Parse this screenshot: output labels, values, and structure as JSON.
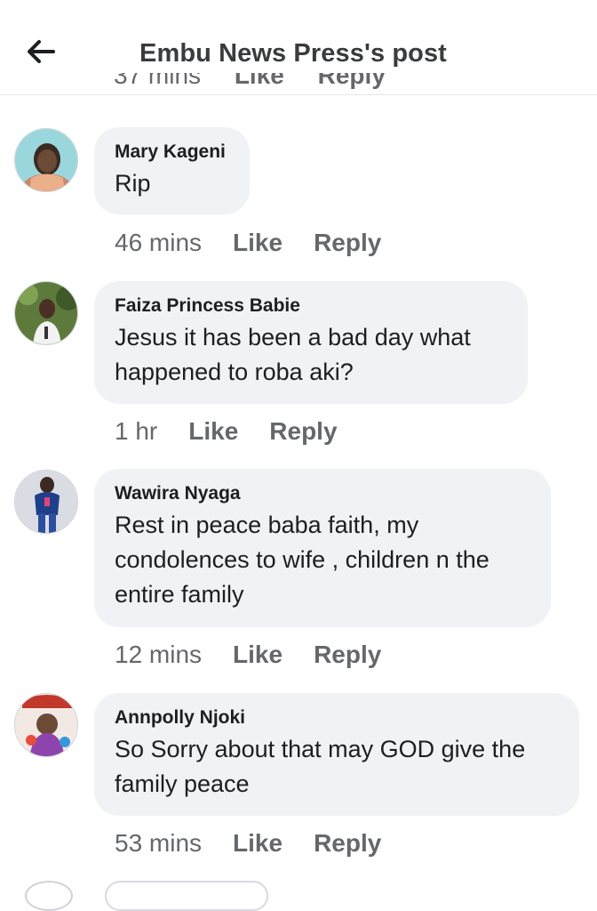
{
  "header": {
    "title": "Embu News Press's post",
    "back_icon": "arrow-left-icon"
  },
  "previous_meta": {
    "time": "37 mins",
    "like": "Like",
    "reply": "Reply"
  },
  "comments": [
    {
      "author": "Mary Kageni",
      "text": "Rip",
      "time": "46 mins",
      "like": "Like",
      "reply": "Reply"
    },
    {
      "author": "Faiza Princess Babie",
      "text": "Jesus it has been a bad day what happened to roba aki?",
      "time": "1 hr",
      "like": "Like",
      "reply": "Reply"
    },
    {
      "author": "Wawira Nyaga",
      "text": "Rest in peace baba faith, my condolences to wife , children n the entire family",
      "time": "12 mins",
      "like": "Like",
      "reply": "Reply"
    },
    {
      "author": "Annpolly Njoki",
      "text": "So Sorry about that may GOD give the family peace",
      "time": "53 mins",
      "like": "Like",
      "reply": "Reply"
    }
  ]
}
